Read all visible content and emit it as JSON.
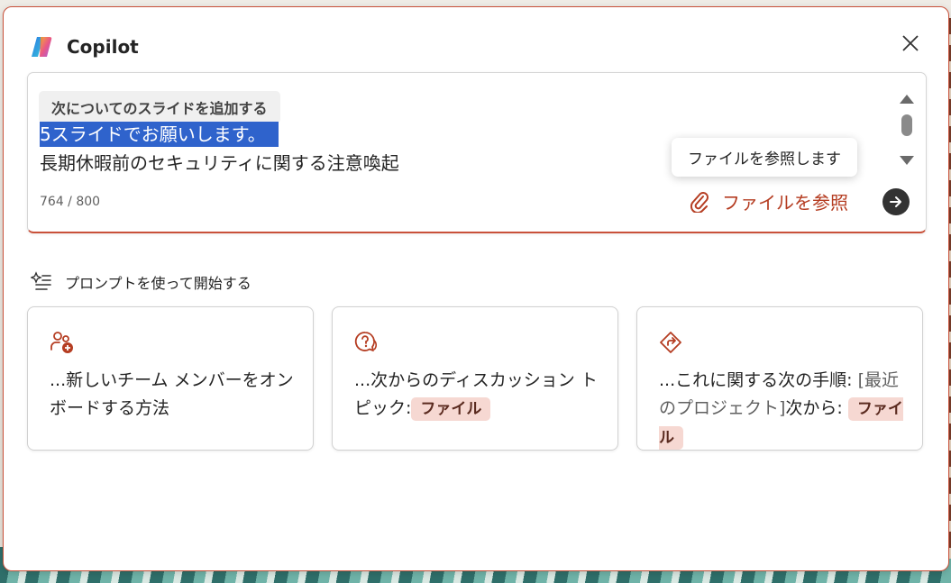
{
  "app": {
    "title": "Copilot"
  },
  "editor": {
    "prefix_chip": "次についてのスライドを追加する",
    "line1_selected": "5スライドでお願いします。",
    "line2": "長期休暇前のセキュリティに関する注意喚起",
    "counter": "764 / 800",
    "tooltip": "ファイルを参照します",
    "browse_label": "ファイルを参照"
  },
  "prompts": {
    "heading": "プロンプトを使って開始する",
    "cards": [
      {
        "text": "...新しいチーム メンバーをオンボードする方法"
      },
      {
        "text": "...次からのディスカッション トピック:",
        "chip": "ファイル"
      },
      {
        "text_a": "...これに関する次の手順: ",
        "placeholder": "[最近のプロジェクト]",
        "text_b": "次から: ",
        "chip": "ファイル"
      }
    ]
  },
  "colors": {
    "accent": "#c9513a",
    "accent_text": "#b53d22",
    "selection": "#2f63cc",
    "chip_bg": "#f6d8d2"
  },
  "icons": [
    "copilot-logo",
    "close-icon",
    "paperclip-icon",
    "send-arrow-icon",
    "prompt-sparkle-icon",
    "people-add-icon",
    "chat-question-icon",
    "direction-sign-icon"
  ]
}
